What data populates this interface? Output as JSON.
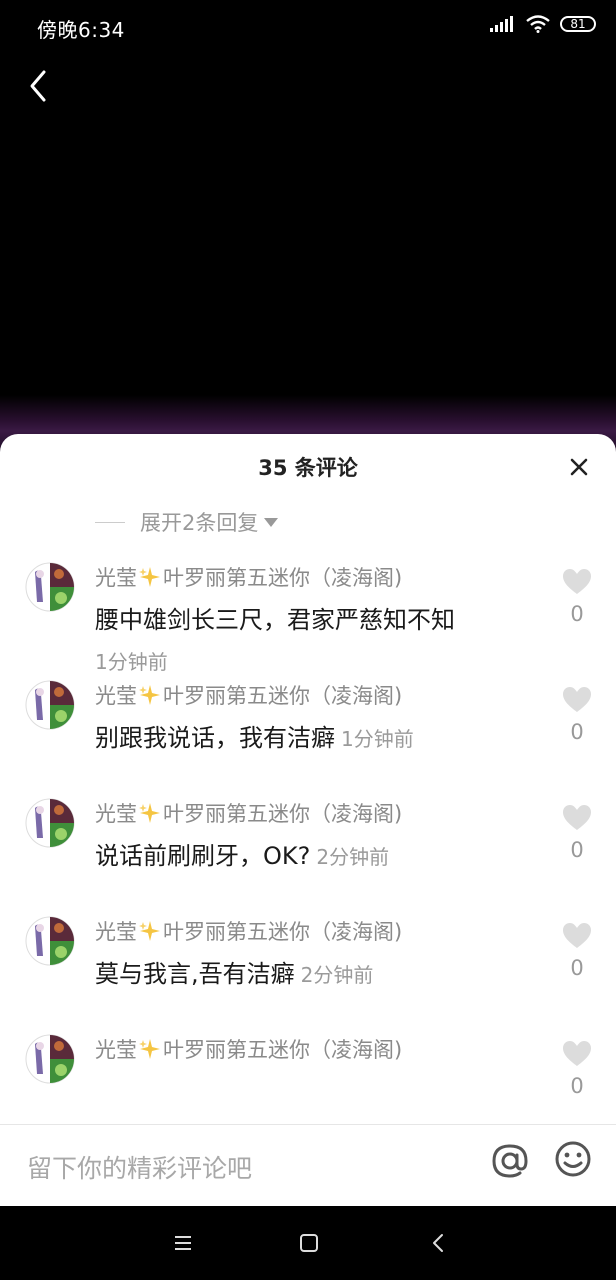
{
  "status_bar": {
    "time": "傍晚6:34",
    "battery": "81"
  },
  "sheet": {
    "title": "35 条评论",
    "expand_label": "展开2条回复"
  },
  "comments": [
    {
      "author": "光莹",
      "author_suffix": "叶罗丽第五迷你（凌海阁)",
      "text": "腰中雄剑长三尺，君家严慈知不知",
      "time": "1分钟前",
      "time_inline": false,
      "likes": "0"
    },
    {
      "author": "光莹",
      "author_suffix": "叶罗丽第五迷你（凌海阁)",
      "text": "别跟我说话，我有洁癖",
      "time": "1分钟前",
      "time_inline": true,
      "likes": "0"
    },
    {
      "author": "光莹",
      "author_suffix": "叶罗丽第五迷你（凌海阁)",
      "text": "说话前刷刷牙，OK?",
      "time": "2分钟前",
      "time_inline": true,
      "likes": "0"
    },
    {
      "author": "光莹",
      "author_suffix": "叶罗丽第五迷你（凌海阁)",
      "text": "莫与我言,吾有洁癖",
      "time": "2分钟前",
      "time_inline": true,
      "likes": "0"
    },
    {
      "author": "光莹",
      "author_suffix": "叶罗丽第五迷你（凌海阁)",
      "text": "",
      "time": "",
      "time_inline": true,
      "likes": "0"
    }
  ],
  "input": {
    "placeholder": "留下你的精彩评论吧"
  },
  "icons": {
    "back": "chevron-left-icon",
    "close": "close-icon",
    "heart": "heart-icon",
    "at": "at-icon",
    "emoji": "emoji-icon",
    "menu": "menu-icon",
    "home": "home-square-icon",
    "nav_back": "nav-back-icon"
  },
  "colors": {
    "sheet_bg": "#ffffff",
    "muted_text": "#999999",
    "primary_text": "#1a1a1a",
    "sparkle": "#f5c542"
  }
}
